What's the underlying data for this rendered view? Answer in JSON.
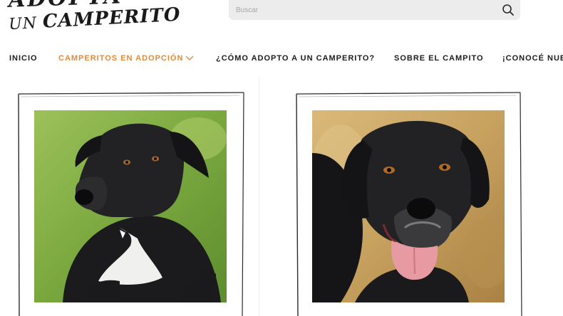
{
  "logo": {
    "line1": "ADOPTÁ",
    "line2_prefix": "UN ",
    "line2_word": "CAMPERITO"
  },
  "search": {
    "placeholder": "Buscar",
    "value": ""
  },
  "nav": {
    "items": [
      {
        "label": "INICIO"
      },
      {
        "label": "CAMPERITOS EN ADOPCIÓN"
      },
      {
        "label": "¿CÓMO ADOPTO A UN CAMPERITO?"
      },
      {
        "label": "SOBRE EL CAMPITO"
      },
      {
        "label": "¡CONOCÉ NUE"
      }
    ],
    "active_color": "#e08b3c"
  },
  "cards": [
    {
      "icon": "black-dog-photo"
    },
    {
      "icon": "black-labrador-photo"
    }
  ]
}
